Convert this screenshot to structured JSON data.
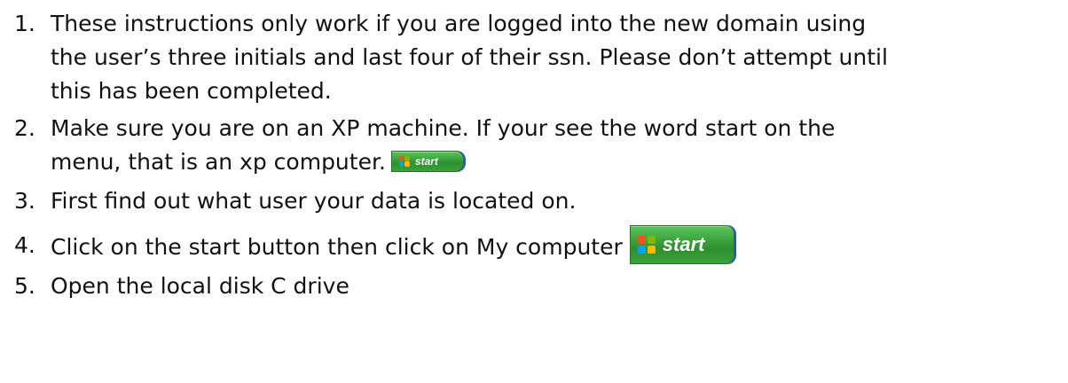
{
  "list": {
    "items": [
      {
        "number": "1.",
        "lines": [
          "These instructions only work if you are logged into the new domain using",
          "the user’s three initials and last four of their ssn. Please don’t attempt until",
          "this has been completed."
        ]
      },
      {
        "number": "2.",
        "lines": [
          "Make sure you are on an XP machine. If your see the word start on the",
          "menu, that is an xp computer."
        ],
        "start_button_label": "start"
      },
      {
        "number": "3.",
        "lines": [
          "First find out what user your data is located on."
        ]
      },
      {
        "number": "4.",
        "lines": [
          "Click on the start button then click on  My computer"
        ],
        "start_button_label": "start"
      },
      {
        "number": "5.",
        "lines": [
          "Open the local disk C drive"
        ]
      }
    ]
  },
  "icons": {
    "start_button": "windows-xp-start-button",
    "windows_flag": "windows-flag-icon"
  },
  "colors": {
    "start_button_green": "#3ea73e",
    "taskbar_blue": "#1c5bc7",
    "text": "#111111"
  }
}
